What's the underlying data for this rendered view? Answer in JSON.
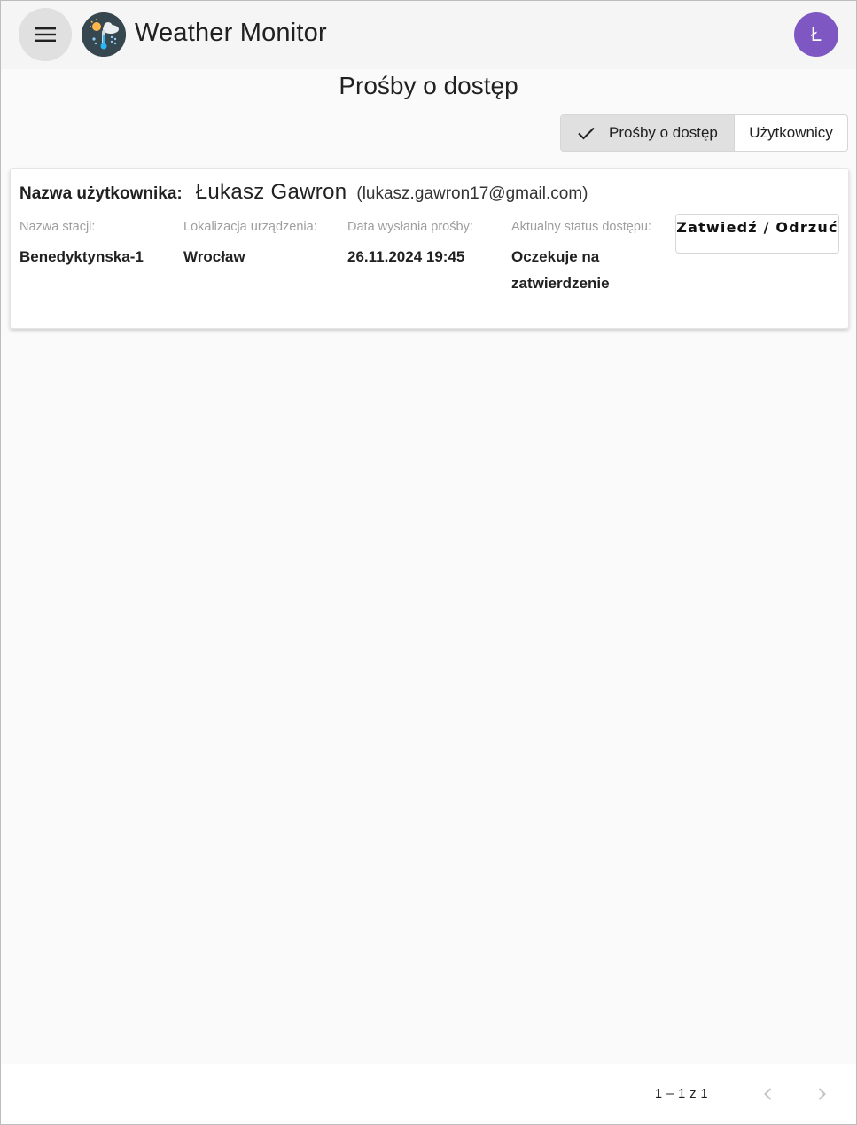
{
  "header": {
    "app_title": "Weather Monitor",
    "avatar_initial": "Ł",
    "menu_icon": "menu-icon",
    "logo_icon": "weather-logo-icon"
  },
  "page": {
    "title": "Prośby o dostęp"
  },
  "toggle": {
    "requests_label": "Prośby o dostęp",
    "users_label": "Użytkownicy",
    "selected": "requests"
  },
  "request": {
    "username_label": "Nazwa użytkownika:",
    "user_name": "Łukasz Gawron",
    "user_email": "(lukasz.gawron17@gmail.com)",
    "fields": [
      {
        "label": "Nazwa stacji:",
        "value": "Benedyktynska-1"
      },
      {
        "label": "Lokalizacja urządzenia:",
        "value": "Wrocław"
      },
      {
        "label": "Data wysłania prośby:",
        "value": "26.11.2024 19:45"
      },
      {
        "label": "Aktualny status dostępu:",
        "value": "Oczekuje na zatwierdzenie"
      }
    ],
    "action_label": "Zatwiedź / Odrzuć"
  },
  "paginator": {
    "range_label": "1 – 1 z 1",
    "prev_icon": "chevron-left-icon",
    "next_icon": "chevron-right-icon"
  },
  "colors": {
    "avatar": "#7e57c2",
    "toolbar": "#f5f5f5",
    "active_toggle": "#e0e0e0",
    "label_gray": "#9e9e9e"
  }
}
